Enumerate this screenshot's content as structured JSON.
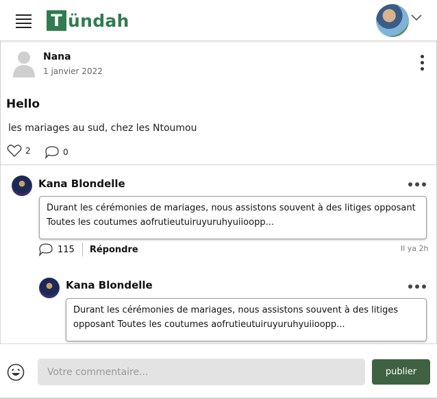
{
  "header": {
    "logo_letter": "T",
    "logo_rest": "ündah",
    "brand_color": "#2f7d4f"
  },
  "post": {
    "author": "Nana",
    "date": "1 janvier 2022",
    "title": "Hello",
    "body": "les mariages au sud, chez les Ntoumou",
    "likes": "2",
    "comments": "0"
  },
  "comments": [
    {
      "author": "Kana Blondelle",
      "text": "Durant les cérémonies de mariages, nous assistons souvent à des litiges opposant Toutes les coutumes aofrutieutuiruyuruhyuiioopp...",
      "reply_count": "115",
      "reply_label": "Répondre",
      "time": "Il ya 2h"
    },
    {
      "author": "Kana Blondelle",
      "text": "Durant les cérémonies de mariages, nous assistons souvent à des litiges opposant Toutes les coutumes aofrutieutuiruyuruhyuiioopp..."
    }
  ],
  "footer": {
    "placeholder": "Votre commentaire...",
    "publish_label": "publier",
    "publish_color": "#3f6242"
  },
  "icons": [
    "menu-icon",
    "chevron-down-icon",
    "user-icon",
    "kebab-icon",
    "heart-icon",
    "comment-icon",
    "emoji-icon"
  ]
}
